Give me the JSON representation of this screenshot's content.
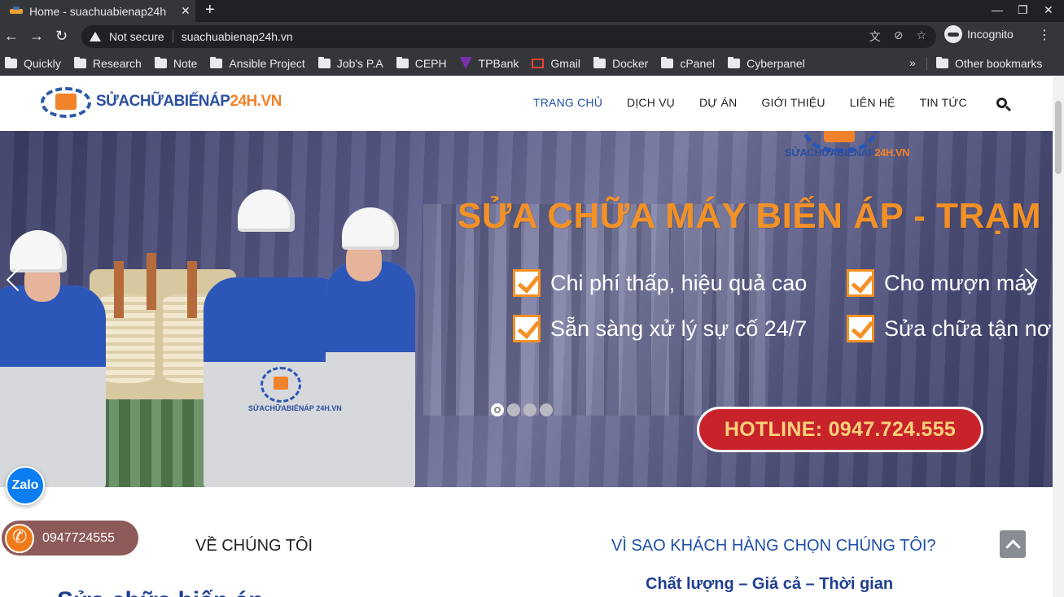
{
  "browser": {
    "tab_title": "Home - suachuabienap24h",
    "tab_close": "✕",
    "new_tab": "+",
    "win_min": "—",
    "win_restore": "❐",
    "win_close": "✕",
    "nav_back": "←",
    "nav_forward": "→",
    "nav_reload": "↻",
    "security_text": "Not secure",
    "url": "suachuabienap24h.vn",
    "incognito_label": "Incognito",
    "menu_dots": "⋮",
    "icons": [
      "translate-icon",
      "eye-off-icon",
      "star-icon"
    ]
  },
  "bookmarks": {
    "items": [
      {
        "label": "Quickly",
        "icon": "folder-icon"
      },
      {
        "label": "Research",
        "icon": "folder-icon"
      },
      {
        "label": "Note",
        "icon": "folder-icon"
      },
      {
        "label": "Ansible Project",
        "icon": "folder-icon"
      },
      {
        "label": "Job's P.A",
        "icon": "folder-icon"
      },
      {
        "label": "CEPH",
        "icon": "folder-icon"
      },
      {
        "label": "TPBank",
        "icon": "tpbank-icon"
      },
      {
        "label": "Gmail",
        "icon": "gmail-icon"
      },
      {
        "label": "Docker",
        "icon": "folder-icon"
      },
      {
        "label": "cPanel",
        "icon": "folder-icon"
      },
      {
        "label": "Cyberpanel",
        "icon": "folder-icon"
      }
    ],
    "more": "»",
    "other": "Other bookmarks"
  },
  "site": {
    "logo": {
      "text_main": "SỬACHỮABIẾNÁP",
      "text_accent": "24H.VN"
    },
    "nav": [
      {
        "label": "TRANG CHỦ",
        "active": true
      },
      {
        "label": "DỊCH VỤ",
        "active": false
      },
      {
        "label": "DỰ ÁN",
        "active": false
      },
      {
        "label": "GIỚI THIỆU",
        "active": false
      },
      {
        "label": "LIÊN HỆ",
        "active": false
      },
      {
        "label": "TIN TỨC",
        "active": false
      }
    ]
  },
  "hero": {
    "logo_text_main": "SỬACHỮABIẾNÁP",
    "logo_text_accent": "24H.VN",
    "shirt_logo_text": "SỬACHỮABIẾNÁP 24H.VN",
    "title": "SỬA CHỮA MÁY BIẾN ÁP - TRẠM",
    "features": [
      "Chi phí thấp, hiệu quả cao",
      "Cho mượn máy",
      "Sẵn sàng xử lý sự cố 24/7",
      "Sửa chữa tận nơ"
    ],
    "hotline": "HOTLINE: 0947.724.555",
    "slides": 4,
    "active_slide": 1
  },
  "widgets": {
    "zalo_label": "Zalo",
    "phone": "0947724555"
  },
  "content": {
    "about_title": "VỀ CHÚNG TÔI",
    "why_title": "VÌ SAO KHÁCH HÀNG CHỌN CHÚNG TÔI?",
    "why_subtitle": "Chất lượng – Giá cả – Thời gian",
    "cut_heading": "Sửa chữa biến áp"
  }
}
